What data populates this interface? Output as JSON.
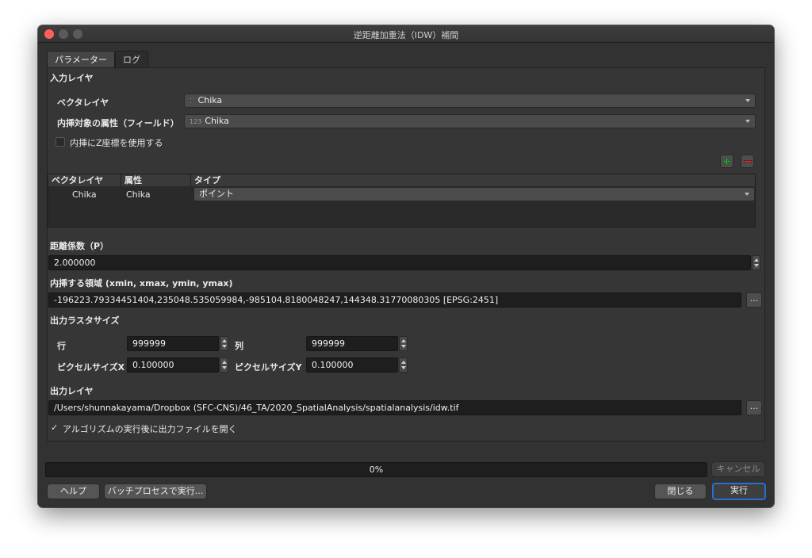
{
  "window": {
    "title": "逆距離加重法（IDW）補間"
  },
  "tabs": [
    {
      "label": "パラメーター"
    },
    {
      "label": "ログ"
    }
  ],
  "input_layers": {
    "section_label": "入力レイヤ",
    "vector_layer_label": "ベクタレイヤ",
    "vector_layer_value": "Chika",
    "attribute_label": "内挿対象の属性（フィールド）",
    "attribute_value": "Chika",
    "use_z_label": "内挿にZ座標を使用する",
    "table": {
      "headers": [
        "ベクタレイヤ",
        "属性",
        "タイプ"
      ],
      "rows": [
        {
          "layer": "Chika",
          "attribute": "Chika",
          "type": "ポイント"
        }
      ]
    }
  },
  "distance": {
    "label": "距離係数（P）",
    "value": "2.000000"
  },
  "extent": {
    "label": "内挿する領域 (xmin, xmax, ymin, ymax)",
    "value": "-196223.79334451404,235048.535059984,-985104.8180048247,144348.31770080305 [EPSG:2451]",
    "button_label": "..."
  },
  "raster_size": {
    "label": "出力ラスタサイズ",
    "rows_label": "行",
    "rows_value": "999999",
    "cols_label": "列",
    "cols_value": "999999",
    "pixel_x_label": "ピクセルサイズX",
    "pixel_x_value": "0.100000",
    "pixel_y_label": "ピクセルサイズY",
    "pixel_y_value": "0.100000"
  },
  "output": {
    "label": "出力レイヤ",
    "value": "/Users/shunnakayama/Dropbox (SFC-CNS)/46_TA/2020_SpatialAnalysis/spatialanalysis/idw.tif",
    "button_label": "...",
    "open_label": "アルゴリズムの実行後に出力ファイルを開く",
    "open_checked": true
  },
  "progress": {
    "percent": 0,
    "text": "0%"
  },
  "buttons": {
    "cancel": "キャンセル",
    "help": "ヘルプ",
    "batch": "バッチプロセスで実行...",
    "close": "閉じる",
    "run": "実行"
  }
}
